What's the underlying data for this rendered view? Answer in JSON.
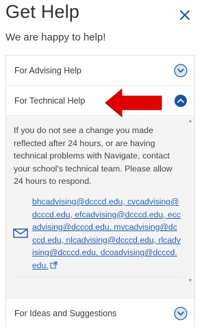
{
  "dialog": {
    "title": "Get Help",
    "subtitle": "We are happy to help!"
  },
  "accordion": {
    "items": [
      {
        "label": "For Advising Help",
        "expanded": false
      },
      {
        "label": "For Technical Help",
        "expanded": true
      },
      {
        "label": "For Ideas and Suggestions",
        "expanded": false
      }
    ],
    "technical_help": {
      "message": "If you do not see a change you made reflected after 24 hours, or are having technical problems with Navigate, contact your school's technical team. Please allow 24 hours to respond.",
      "emails": "bhcadvising@dcccd.edu, cvcadvising@dcccd.edu, efcadvising@dcccd.edu, eccadvising@dcccd.edu, mvcadvising@dcccd.edu, nlcadvising@dcccd.edu, rlcadvising@dcccd.edu, dcoadvising@dcccd.edu."
    }
  },
  "colors": {
    "accent": "#1a56a0",
    "toggle_collapsed_fill": "#dbe6f5",
    "toggle_expanded_fill": "#1a56a0",
    "annotation_arrow": "#e00000"
  },
  "icons": {
    "close": "close-icon",
    "collapsed": "chevron-down-icon",
    "expanded": "chevron-up-icon",
    "email": "envelope-icon",
    "external": "external-link-icon"
  }
}
